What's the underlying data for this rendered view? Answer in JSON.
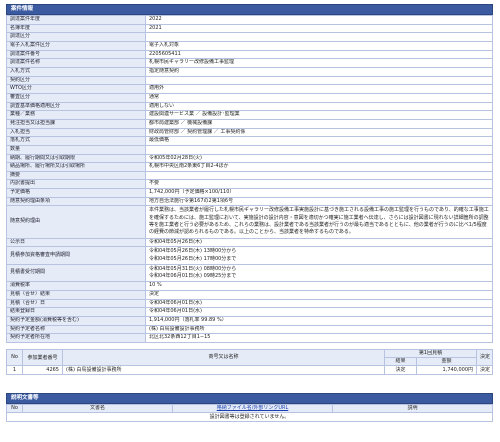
{
  "section1": {
    "title": "案件情報",
    "rows": [
      {
        "k": "調達案件年度",
        "v": "2022"
      },
      {
        "k": "名簿年度",
        "v": "2021"
      },
      {
        "k": "調達区分",
        "v": ""
      },
      {
        "k": "電子入札案件区分",
        "v": "電子入札対象"
      },
      {
        "k": "調達案件番号",
        "v": "2205605411"
      },
      {
        "k": "調達案件名称",
        "v": "札幌市民ギャラリー改修設備工事監理"
      },
      {
        "k": "入札方式",
        "v": "指定随意契約"
      },
      {
        "k": "契約区分",
        "v": ""
      },
      {
        "k": "WTO区分",
        "v": "適用外"
      },
      {
        "k": "審査区分",
        "v": "通常"
      },
      {
        "k": "調査基準価格適用区分",
        "v": "適用しない"
      },
      {
        "k": "業種／業務",
        "v": "建設関連サービス業 ／ 設備設計･監理業"
      },
      {
        "k": "発注担当又は担当課",
        "v": "都市局建築部 ／ 機械設備課"
      },
      {
        "k": "入札担当",
        "v": "財政局管財部 ／ 契約管理課 ／ 工事契約係"
      },
      {
        "k": "落札方式",
        "v": "最低価格"
      },
      {
        "k": "数量",
        "v": ""
      },
      {
        "k": "納期、履行期間又は引取期限",
        "v": "令和05年02月28日(火)"
      },
      {
        "k": "納品場所、履行場所又は引取場所",
        "v": "札幌市中央区南2条東6丁目2-4ほか"
      },
      {
        "k": "摘要",
        "v": ""
      },
      {
        "k": "内訳書提出",
        "v": "不要"
      },
      {
        "k": "予定価格",
        "v": "1,742,000円（予定価格×100/110）"
      },
      {
        "k": "随意契約理由条項",
        "v": "地方自治法施行令第167の2第1項6号"
      },
      {
        "k": "随意契約理由",
        "v": "本件業務は、当該業者が履行した札幌市民ギャラリー改修設備工事実施設計に基づき施工される設備工事の施工監理を行うものであり、的確な工事施工を確保するためには、施工監理において、実施設計の設計内容・意図を適切かつ確実に施工業者へ伝達し、さらには設計図書に現れない詳細箇所の調整等を施工業者と行う必要があるため、これらの業務は、設計業者である当該業者が行うのが最も適当であるとともに、他の業者が行うのに比べ1/5程度の経費の節減が認められるものである。以上のことから、当該業者を特命するものである。"
      },
      {
        "k": "公示日",
        "v": "令和04年05月26日(木)"
      },
      {
        "k": "見積参加資格審査申請期間",
        "v": "令和04年05月26日(木) 13時00分から\n令和04年05月26日(木) 17時00分まで"
      },
      {
        "k": "見積書受付期間",
        "v": "令和04年05月31日(火) 08時00分から\n令和04年06月01日(水) 09時25分まで"
      },
      {
        "k": "消費税率",
        "v": "10 %"
      },
      {
        "k": "見積（合せ）結果",
        "v": "決定"
      },
      {
        "k": "見積（合せ）日",
        "v": "令和04年06月01日(水)"
      },
      {
        "k": "結果登録日",
        "v": "令和04年06月01日(水)"
      },
      {
        "k": "契約予定金額(消費税等を含む)",
        "v": "1,914,000円（落札率 99.89 %）"
      },
      {
        "k": "契約予定者名称",
        "v": "(株) 白鳥設備設計事務所"
      },
      {
        "k": "契約予定者所在地",
        "v": "北区北32条西12丁目1−15"
      }
    ]
  },
  "results": {
    "headers": {
      "no": "No",
      "num": "参加業者番号",
      "name": "商号又は名称",
      "round1": "第1回見積",
      "result": "結果",
      "amount": "金額",
      "decision": "決定"
    },
    "rows": [
      {
        "no": "1",
        "num": "4265",
        "name": "(株) 白鳥設備設計事務所",
        "result": "決定",
        "amount": "1,740,000円",
        "decision": "決定"
      }
    ]
  },
  "section2": {
    "title": "説明文書等",
    "headers": {
      "no": "No",
      "doc": "文書名",
      "type": "格納ファイル名/外部リンクURL",
      "desc": "説明"
    },
    "empty_msg": "設計図書等は登録されていません。"
  }
}
